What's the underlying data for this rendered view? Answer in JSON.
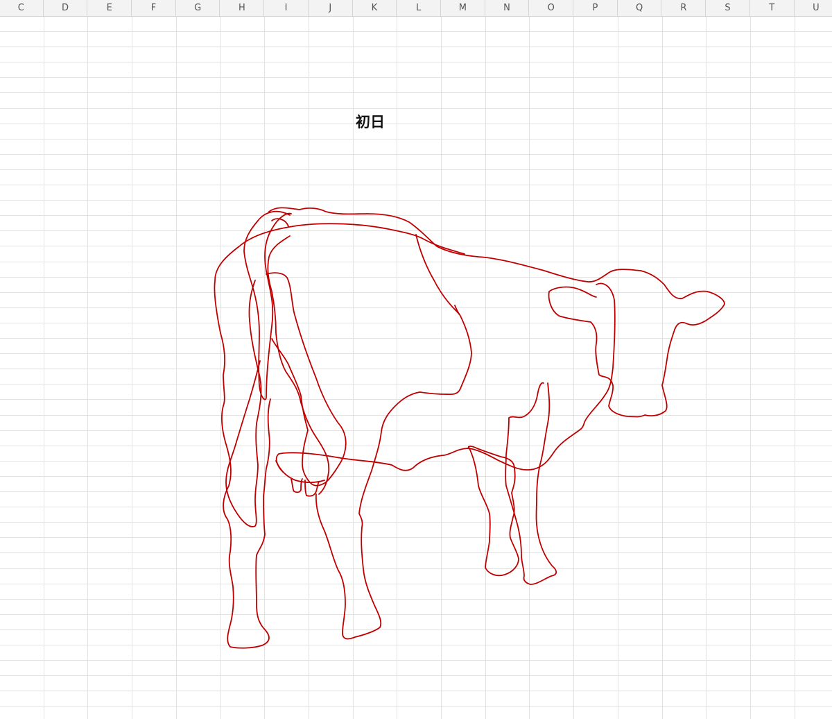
{
  "columns": [
    "C",
    "D",
    "E",
    "F",
    "G",
    "H",
    "I",
    "J",
    "K",
    "L",
    "M",
    "N",
    "O",
    "P",
    "Q",
    "R",
    "S",
    "T",
    "U"
  ],
  "title_cell": {
    "text": "初日"
  },
  "drawing": {
    "subject": "freehand-ink-drawing",
    "stroke_color": "#c00000"
  },
  "colors": {
    "grid_line": "#e2e2e2",
    "header_bg": "#f3f3f3",
    "header_text": "#555555",
    "ink": "#c00000"
  }
}
